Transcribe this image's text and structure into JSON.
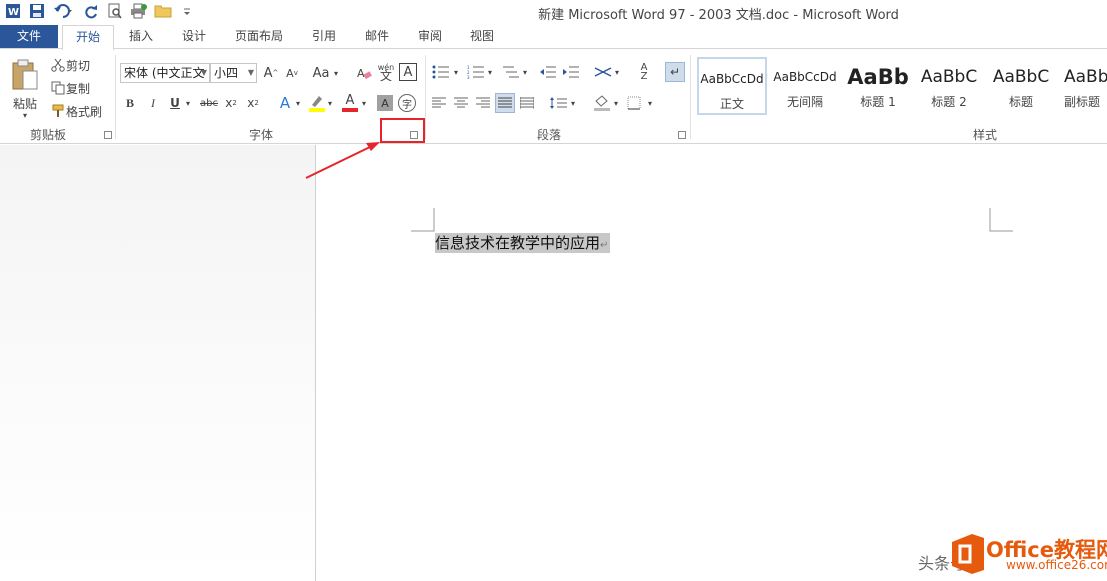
{
  "window": {
    "title": "新建 Microsoft Word 97 - 2003 文档.doc - Microsoft Word"
  },
  "tabs": [
    "文件",
    "开始",
    "插入",
    "设计",
    "页面布局",
    "引用",
    "邮件",
    "审阅",
    "视图"
  ],
  "clipboard": {
    "paste": "粘贴",
    "cut": "剪切",
    "copy": "复制",
    "format_painter": "格式刷",
    "label": "剪贴板"
  },
  "font": {
    "family": "宋体 (中文正文",
    "size": "小四",
    "label": "字体",
    "change_case": "Aa",
    "pinyin": "wén",
    "pinyin_char": "文"
  },
  "paragraph": {
    "label": "段落"
  },
  "styles": {
    "label": "样式",
    "items": [
      {
        "sample": "AaBbCcDd",
        "name": "正文"
      },
      {
        "sample": "AaBbCcDd",
        "name": "无间隔"
      },
      {
        "sample": "AaBb",
        "name": "标题 1"
      },
      {
        "sample": "AaBbC",
        "name": "标题 2"
      },
      {
        "sample": "AaBbC",
        "name": "标题"
      },
      {
        "sample": "AaBb",
        "name": "副标题"
      }
    ]
  },
  "document": {
    "text": "信息技术在教学中的应用"
  },
  "watermark": {
    "title": "Office教程网",
    "url": "www.office26.com",
    "prefix": "头条号"
  },
  "colors": {
    "accent": "#2b579a",
    "highlight": "#e5252a",
    "brand_orange": "#e65a0d"
  }
}
